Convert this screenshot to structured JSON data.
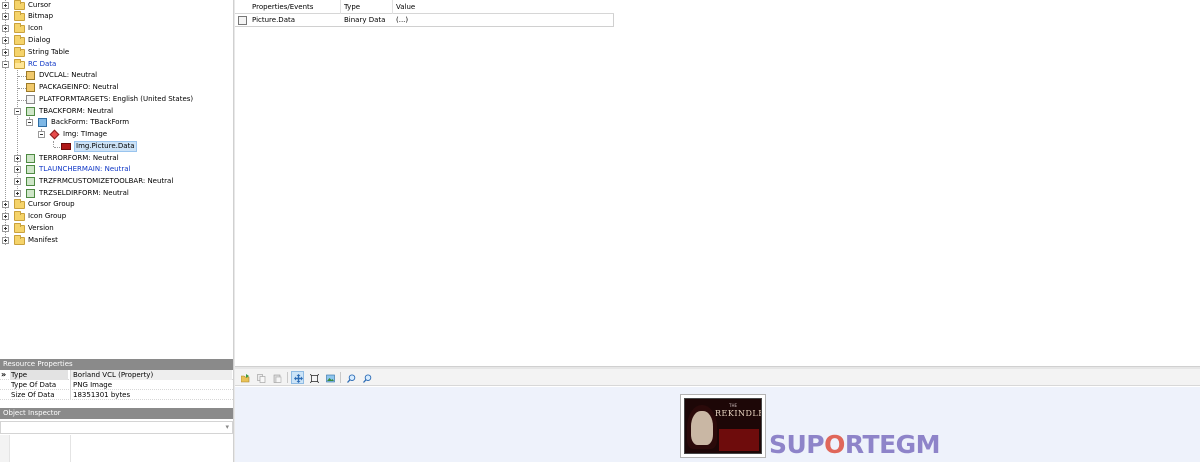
{
  "tree": {
    "items": [
      {
        "label": "Cursor"
      },
      {
        "label": "Bitmap"
      },
      {
        "label": "Icon"
      },
      {
        "label": "Dialog"
      },
      {
        "label": "String Table"
      },
      {
        "label": "RC Data"
      },
      {
        "label": "DVCLAL: Neutral"
      },
      {
        "label": "PACKAGEINFO: Neutral"
      },
      {
        "label": "PLATFORMTARGETS: English (United States)"
      },
      {
        "label": "TBACKFORM: Neutral"
      },
      {
        "label": "BackForm: TBackForm"
      },
      {
        "label": "Img: TImage"
      },
      {
        "label": "Img.Picture.Data"
      },
      {
        "label": "TERRORFORM: Neutral"
      },
      {
        "label": "TLAUNCHERMAIN: Neutral"
      },
      {
        "label": "TRZFRMCUSTOMIZETOOLBAR: Neutral"
      },
      {
        "label": "TRZSELDIRFORM: Neutral"
      },
      {
        "label": "Cursor Group"
      },
      {
        "label": "Icon Group"
      },
      {
        "label": "Version"
      },
      {
        "label": "Manifest"
      }
    ]
  },
  "resource_properties": {
    "title": "Resource Properties",
    "rows": [
      {
        "key": "Type",
        "value": "Borland VCL (Property)"
      },
      {
        "key": "Type Of Data",
        "value": "PNG Image"
      },
      {
        "key": "Size Of Data",
        "value": "18351301 bytes"
      }
    ]
  },
  "object_inspector": {
    "title": "Object Inspector",
    "selected": ""
  },
  "properties_table": {
    "headers": [
      "Properties/Events",
      "Type",
      "Value"
    ],
    "rows": [
      {
        "name": "Picture.Data",
        "type": "Binary Data",
        "value": "(...)"
      }
    ]
  },
  "toolbar": {
    "buttons": [
      "open-icon",
      "copy-icon",
      "paste-icon",
      "fit-icon",
      "actual-size-icon",
      "image-icon",
      "zoom-in-icon",
      "zoom-out-icon"
    ]
  },
  "preview": {
    "image_text": "REKINDLE",
    "image_small_text": "THE"
  },
  "watermark": {
    "part1": "SUP",
    "part2": "O",
    "part3": "RTEGM"
  },
  "colors": {
    "accent_selection": "#cde3f7",
    "link_blue": "#0e36c6",
    "panel_header": "#8a8a8a",
    "preview_bg": "#eef2fb",
    "watermark": "#8e84c9",
    "watermark_accent": "#e0675a"
  }
}
